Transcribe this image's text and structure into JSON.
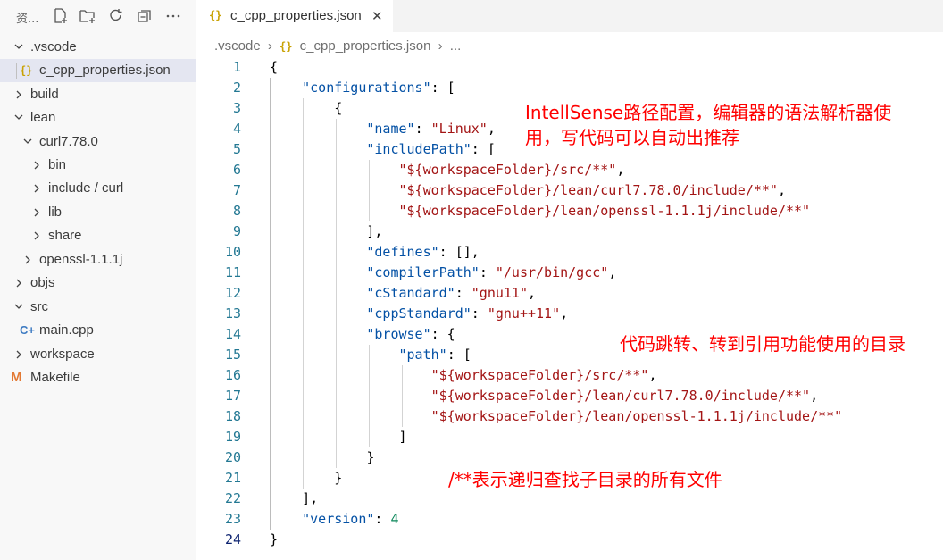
{
  "sidebar": {
    "title": "资...",
    "actions": [
      "new-file-icon",
      "new-folder-icon",
      "refresh-icon",
      "collapse-icon",
      "more-icon"
    ],
    "items": [
      {
        "label": ".vscode",
        "depth": 0,
        "kind": "folder-open"
      },
      {
        "label": "c_cpp_properties.json",
        "depth": 1,
        "kind": "json",
        "selected": true
      },
      {
        "label": "build",
        "depth": 0,
        "kind": "folder"
      },
      {
        "label": "lean",
        "depth": 0,
        "kind": "folder-open"
      },
      {
        "label": "curl7.78.0",
        "depth": 1,
        "kind": "folder-open"
      },
      {
        "label": "bin",
        "depth": 2,
        "kind": "folder"
      },
      {
        "label": "include / curl",
        "depth": 2,
        "kind": "folder"
      },
      {
        "label": "lib",
        "depth": 2,
        "kind": "folder"
      },
      {
        "label": "share",
        "depth": 2,
        "kind": "folder"
      },
      {
        "label": "openssl-1.1.1j",
        "depth": 1,
        "kind": "folder"
      },
      {
        "label": "objs",
        "depth": 0,
        "kind": "folder"
      },
      {
        "label": "src",
        "depth": 0,
        "kind": "folder-open"
      },
      {
        "label": "main.cpp",
        "depth": 1,
        "kind": "cpp"
      },
      {
        "label": "workspace",
        "depth": 0,
        "kind": "folder"
      },
      {
        "label": "Makefile",
        "depth": 0,
        "kind": "makefile"
      }
    ]
  },
  "tab": {
    "icon": "{}",
    "label": "c_cpp_properties.json",
    "close": "✕"
  },
  "breadcrumb": {
    "folder": ".vscode",
    "sep": "›",
    "icon": "{}",
    "file": "c_cpp_properties.json",
    "tail": "..."
  },
  "code": {
    "active_line": 24,
    "lines": [
      [
        [
          "p",
          "{"
        ]
      ],
      [
        [
          "p",
          "    "
        ],
        [
          "k",
          "\"configurations\""
        ],
        [
          "p",
          ": ["
        ]
      ],
      [
        [
          "p",
          "        {"
        ]
      ],
      [
        [
          "p",
          "            "
        ],
        [
          "k",
          "\"name\""
        ],
        [
          "p",
          ": "
        ],
        [
          "s",
          "\"Linux\""
        ],
        [
          "p",
          ","
        ]
      ],
      [
        [
          "p",
          "            "
        ],
        [
          "k",
          "\"includePath\""
        ],
        [
          "p",
          ": ["
        ]
      ],
      [
        [
          "p",
          "                "
        ],
        [
          "s",
          "\"${workspaceFolder}/src/**\""
        ],
        [
          "p",
          ","
        ]
      ],
      [
        [
          "p",
          "                "
        ],
        [
          "s",
          "\"${workspaceFolder}/lean/curl7.78.0/include/**\""
        ],
        [
          "p",
          ","
        ]
      ],
      [
        [
          "p",
          "                "
        ],
        [
          "s",
          "\"${workspaceFolder}/lean/openssl-1.1.1j/include/**\""
        ]
      ],
      [
        [
          "p",
          "            ],"
        ]
      ],
      [
        [
          "p",
          "            "
        ],
        [
          "k",
          "\"defines\""
        ],
        [
          "p",
          ": [],"
        ]
      ],
      [
        [
          "p",
          "            "
        ],
        [
          "k",
          "\"compilerPath\""
        ],
        [
          "p",
          ": "
        ],
        [
          "s",
          "\"/usr/bin/gcc\""
        ],
        [
          "p",
          ","
        ]
      ],
      [
        [
          "p",
          "            "
        ],
        [
          "k",
          "\"cStandard\""
        ],
        [
          "p",
          ": "
        ],
        [
          "s",
          "\"gnu11\""
        ],
        [
          "p",
          ","
        ]
      ],
      [
        [
          "p",
          "            "
        ],
        [
          "k",
          "\"cppStandard\""
        ],
        [
          "p",
          ": "
        ],
        [
          "s",
          "\"gnu++11\""
        ],
        [
          "p",
          ","
        ]
      ],
      [
        [
          "p",
          "            "
        ],
        [
          "k",
          "\"browse\""
        ],
        [
          "p",
          ": {"
        ]
      ],
      [
        [
          "p",
          "                "
        ],
        [
          "k",
          "\"path\""
        ],
        [
          "p",
          ": ["
        ]
      ],
      [
        [
          "p",
          "                    "
        ],
        [
          "s",
          "\"${workspaceFolder}/src/**\""
        ],
        [
          "p",
          ","
        ]
      ],
      [
        [
          "p",
          "                    "
        ],
        [
          "s",
          "\"${workspaceFolder}/lean/curl7.78.0/include/**\""
        ],
        [
          "p",
          ","
        ]
      ],
      [
        [
          "p",
          "                    "
        ],
        [
          "s",
          "\"${workspaceFolder}/lean/openssl-1.1.1j/include/**\""
        ]
      ],
      [
        [
          "p",
          "                ]"
        ]
      ],
      [
        [
          "p",
          "            }"
        ]
      ],
      [
        [
          "p",
          "        }"
        ]
      ],
      [
        [
          "p",
          "    ],"
        ]
      ],
      [
        [
          "p",
          "    "
        ],
        [
          "k",
          "\"version\""
        ],
        [
          "p",
          ": "
        ],
        [
          "n",
          "4"
        ]
      ],
      [
        [
          "p",
          "}"
        ]
      ]
    ]
  },
  "annotations": {
    "intellisense_line1": "IntellSense路径配置，编辑器的语法解析器使",
    "intellisense_line2": "用，写代码可以自动出推荐",
    "browse": "代码跳转、转到引用功能使用的目录",
    "wildcard": "/**表示递归查找子目录的所有文件"
  },
  "colors": {
    "key": "#0451a5",
    "string": "#a31515",
    "number": "#098658",
    "annotation": "#ff0000",
    "line_number": "#237893"
  }
}
